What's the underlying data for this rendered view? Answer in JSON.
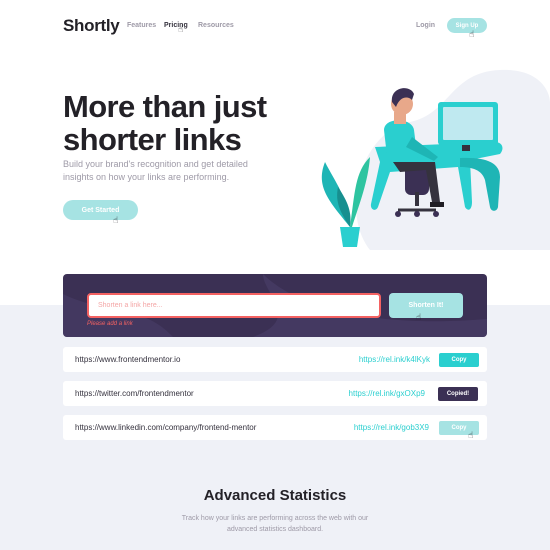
{
  "header": {
    "logo": "Shortly",
    "nav": [
      {
        "label": "Features"
      },
      {
        "label": "Pricing"
      },
      {
        "label": "Resources"
      }
    ],
    "login_label": "Login",
    "signup_label": "Sign Up"
  },
  "hero": {
    "title": "More than just shorter links",
    "description": "Build your brand's recognition and get detailed insights on how your links are performing.",
    "cta_label": "Get Started"
  },
  "shorten": {
    "placeholder": "Shorten a link here...",
    "error": "Please add a link",
    "button_label": "Shorten It!"
  },
  "results": [
    {
      "original": "https://www.frontendmentor.io",
      "short": "https://rel.ink/k4lKyk",
      "button": "Copy",
      "state": "default"
    },
    {
      "original": "https://twitter.com/frontendmentor",
      "short": "https://rel.ink/gxOXp9",
      "button": "Copied!",
      "state": "copied"
    },
    {
      "original": "https://www.linkedin.com/company/frontend-mentor",
      "short": "https://rel.ink/gob3X9",
      "button": "Copy",
      "state": "hover"
    }
  ],
  "stats": {
    "title": "Advanced Statistics",
    "description": "Track how your links are performing across the web with our advanced statistics dashboard."
  },
  "colors": {
    "cyan": "#2acfcf",
    "cyan_light": "#a6e3e3",
    "dark_violet": "#3b3054",
    "red": "#f46262",
    "gray_bg": "#eff1f7"
  }
}
